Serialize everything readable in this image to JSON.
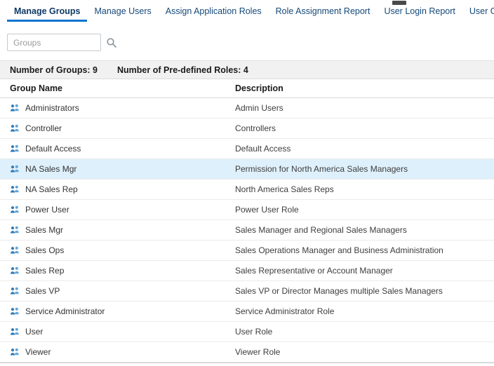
{
  "tabs": [
    {
      "label": "Manage Groups",
      "active": true
    },
    {
      "label": "Manage Users",
      "active": false
    },
    {
      "label": "Assign Application Roles",
      "active": false
    },
    {
      "label": "Role Assignment Report",
      "active": false
    },
    {
      "label": "User Login Report",
      "active": false
    },
    {
      "label": "User Group Report",
      "active": false
    }
  ],
  "search": {
    "placeholder": "Groups",
    "value": "",
    "icon": "magnifier-icon"
  },
  "summary": {
    "groups_count_label": "Number of Groups: 9",
    "roles_count_label": "Number of Pre-defined Roles: 4"
  },
  "table": {
    "columns": [
      "Group Name",
      "Description"
    ],
    "selected_index": 3,
    "rows": [
      {
        "name": "Administrators",
        "description": "Admin Users"
      },
      {
        "name": "Controller",
        "description": "Controllers"
      },
      {
        "name": "Default Access",
        "description": "Default Access"
      },
      {
        "name": "NA Sales Mgr",
        "description": "Permission for North America Sales Managers"
      },
      {
        "name": "NA Sales Rep",
        "description": "North America Sales Reps"
      },
      {
        "name": "Power User",
        "description": "Power User Role"
      },
      {
        "name": "Sales Mgr",
        "description": "Sales Manager and Regional Sales Managers"
      },
      {
        "name": "Sales Ops",
        "description": "Sales Operations Manager and Business Administration"
      },
      {
        "name": "Sales Rep",
        "description": "Sales Representative or Account Manager"
      },
      {
        "name": "Sales VP",
        "description": "Sales VP or Director Manages multiple Sales Managers"
      },
      {
        "name": "Service Administrator",
        "description": "Service Administrator Role"
      },
      {
        "name": "User",
        "description": "User Role"
      },
      {
        "name": "Viewer",
        "description": "Viewer Role"
      }
    ]
  },
  "colors": {
    "accent": "#0572ce",
    "tab_text": "#15497a",
    "selected_row": "#def0fb",
    "summary_bg": "#f1f1f1",
    "icon_dark": "#2e7bb8",
    "icon_light": "#63a5d8"
  }
}
